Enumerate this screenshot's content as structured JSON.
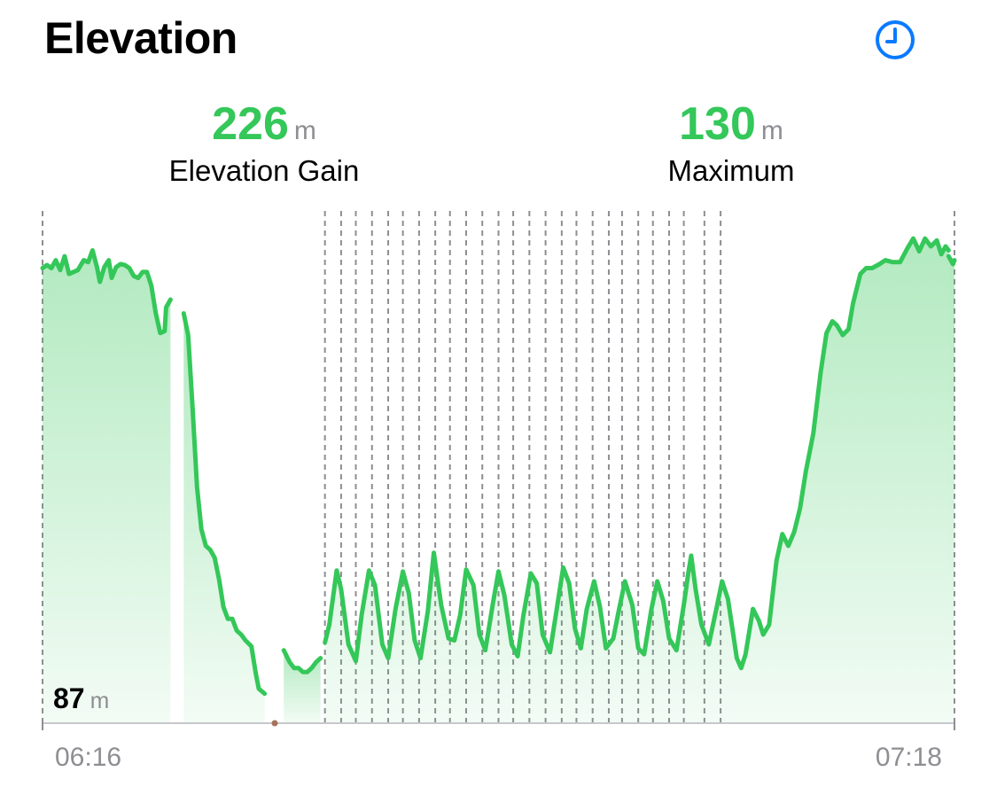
{
  "header": {
    "title": "Elevation",
    "clock_icon": "clock-icon"
  },
  "stats": {
    "gain": {
      "value": "226",
      "unit": "m",
      "label": "Elevation Gain"
    },
    "max": {
      "value": "130",
      "unit": "m",
      "label": "Maximum"
    }
  },
  "colors": {
    "accent": "#34c759",
    "link": "#0a7aff",
    "secondary_text": "#8e8e93"
  },
  "chart_data": {
    "type": "area",
    "xlabel": "",
    "ylabel": "",
    "y_unit": "m",
    "x_ticks": [
      "06:16",
      "07:18"
    ],
    "x_range_minutes": [
      0,
      62
    ],
    "ylim": [
      82,
      134
    ],
    "grid": "dashed vertical segment markers",
    "min_label": {
      "value": "87",
      "unit": "m"
    },
    "segments": [
      {
        "points": [
          [
            0,
            128.2
          ],
          [
            0.3,
            128.5
          ],
          [
            0.6,
            128.2
          ],
          [
            0.9,
            129
          ],
          [
            1.2,
            128
          ],
          [
            1.5,
            129.4
          ],
          [
            1.8,
            127.6
          ],
          [
            2.1,
            127.8
          ],
          [
            2.4,
            128
          ],
          [
            2.8,
            129
          ],
          [
            3.1,
            128.8
          ],
          [
            3.4,
            130
          ],
          [
            3.7,
            128.3
          ],
          [
            3.9,
            126.8
          ],
          [
            4.2,
            128.3
          ],
          [
            4.5,
            129
          ],
          [
            4.7,
            127.2
          ],
          [
            5,
            128.3
          ],
          [
            5.3,
            128.6
          ],
          [
            5.6,
            128.5
          ],
          [
            5.9,
            128.2
          ],
          [
            6.2,
            127.4
          ],
          [
            6.5,
            127.2
          ],
          [
            6.8,
            127.8
          ],
          [
            7.1,
            127.8
          ],
          [
            7.4,
            126.4
          ],
          [
            7.7,
            123.6
          ],
          [
            8.0,
            121.6
          ],
          [
            8.3,
            121.8
          ],
          [
            8.4,
            124.2
          ],
          [
            8.7,
            125.0
          ]
        ]
      },
      {
        "points": [
          [
            9.6,
            123.6
          ],
          [
            9.9,
            121.4
          ],
          [
            10.2,
            114
          ],
          [
            10.5,
            106
          ],
          [
            10.8,
            101.7
          ],
          [
            11.1,
            100
          ],
          [
            11.4,
            99.6
          ],
          [
            11.7,
            98.8
          ],
          [
            12,
            96.6
          ],
          [
            12.3,
            93.8
          ],
          [
            12.6,
            92.6
          ],
          [
            12.9,
            92.6
          ],
          [
            13.2,
            91.4
          ],
          [
            13.5,
            91.0
          ],
          [
            13.8,
            90.4
          ],
          [
            14.2,
            89.8
          ],
          [
            14.5,
            87
          ],
          [
            14.7,
            85.5
          ],
          [
            15.1,
            85
          ]
        ]
      },
      {
        "points": [
          [
            16.4,
            89.4
          ],
          [
            16.8,
            88.2
          ],
          [
            17.1,
            87.6
          ],
          [
            17.4,
            87.6
          ],
          [
            17.7,
            87.2
          ],
          [
            18.0,
            87.2
          ],
          [
            18.3,
            87.6
          ],
          [
            18.6,
            88.2
          ],
          [
            18.9,
            88.6
          ]
        ]
      },
      {
        "points": [
          [
            19.2,
            90.2
          ],
          [
            19.5,
            92
          ],
          [
            20.0,
            97.5
          ],
          [
            20.3,
            95.6
          ],
          [
            20.8,
            90
          ],
          [
            21.3,
            88.3
          ],
          [
            21.7,
            93
          ],
          [
            22.2,
            97.5
          ],
          [
            22.6,
            96
          ],
          [
            23.1,
            90
          ],
          [
            23.5,
            88.6
          ],
          [
            24.0,
            93.6
          ],
          [
            24.5,
            97.4
          ],
          [
            24.9,
            95.2
          ],
          [
            25.3,
            90.4
          ],
          [
            25.7,
            88.6
          ],
          [
            26.2,
            93.4
          ],
          [
            26.6,
            99.3
          ],
          [
            27.1,
            94
          ],
          [
            27.6,
            90.6
          ],
          [
            28.0,
            90.4
          ],
          [
            28.4,
            93
          ],
          [
            28.8,
            97.6
          ],
          [
            29.3,
            96
          ],
          [
            29.7,
            91
          ],
          [
            30.1,
            89.4
          ],
          [
            30.6,
            94
          ],
          [
            31.0,
            97.4
          ],
          [
            31.4,
            95
          ],
          [
            31.9,
            90
          ],
          [
            32.3,
            88.8
          ],
          [
            32.7,
            93
          ],
          [
            33.2,
            97.2
          ],
          [
            33.6,
            96.2
          ],
          [
            34.0,
            91
          ],
          [
            34.5,
            89.2
          ],
          [
            34.9,
            93
          ],
          [
            35.4,
            97.8
          ],
          [
            35.8,
            96.2
          ],
          [
            36.2,
            91.6
          ],
          [
            36.6,
            89.6
          ],
          [
            37.0,
            93.6
          ],
          [
            37.5,
            96.4
          ],
          [
            37.9,
            93.8
          ],
          [
            38.3,
            89.6
          ],
          [
            38.8,
            90.6
          ],
          [
            39.2,
            93.6
          ],
          [
            39.6,
            96.4
          ],
          [
            40.1,
            94
          ],
          [
            40.5,
            89.6
          ],
          [
            40.9,
            89
          ],
          [
            41.4,
            93.6
          ],
          [
            41.8,
            96.4
          ],
          [
            42.2,
            94.4
          ],
          [
            42.6,
            90.6
          ],
          [
            43.1,
            89.4
          ],
          [
            43.6,
            94
          ],
          [
            43.9,
            97.2
          ],
          [
            44.1,
            99
          ],
          [
            44.4,
            95.6
          ],
          [
            44.8,
            92
          ],
          [
            45.3,
            90
          ],
          [
            45.8,
            93.5
          ],
          [
            46.2,
            96.4
          ],
          [
            46.6,
            94.6
          ],
          [
            47.2,
            88.6
          ],
          [
            47.5,
            87.6
          ],
          [
            47.8,
            89
          ],
          [
            48.3,
            93.6
          ],
          [
            48.7,
            92.4
          ],
          [
            49.0,
            91
          ],
          [
            49.4,
            92
          ],
          [
            49.9,
            98.5
          ],
          [
            50.3,
            101.2
          ],
          [
            50.7,
            100
          ],
          [
            51.1,
            101.4
          ],
          [
            51.5,
            103.8
          ],
          [
            51.9,
            107.6
          ],
          [
            52.4,
            111.4
          ],
          [
            52.9,
            117.6
          ],
          [
            53.3,
            121.6
          ],
          [
            53.7,
            122.8
          ],
          [
            54.0,
            122.4
          ],
          [
            54.4,
            121.4
          ],
          [
            54.8,
            122.0
          ],
          [
            55.1,
            124.6
          ],
          [
            55.6,
            127.6
          ],
          [
            56.0,
            128.2
          ],
          [
            56.4,
            128.2
          ],
          [
            56.9,
            128.6
          ],
          [
            57.3,
            129
          ],
          [
            57.8,
            128.8
          ],
          [
            58.3,
            128.8
          ],
          [
            58.8,
            130.2
          ],
          [
            59.2,
            131.2
          ],
          [
            59.6,
            129.9
          ],
          [
            60.0,
            131.2
          ],
          [
            60.4,
            130.4
          ],
          [
            60.8,
            131
          ],
          [
            61.1,
            129.6
          ],
          [
            61.4,
            130.4
          ],
          [
            61.6,
            130
          ]
        ]
      },
      {
        "points": [
          [
            61.6,
            129.4
          ],
          [
            61.9,
            128.6
          ],
          [
            62,
            129
          ]
        ]
      }
    ],
    "marker_times": [
      0,
      19.2,
      20.3,
      21.3,
      22.4,
      23.5,
      24.5,
      25.6,
      26.7,
      27.7,
      28.8,
      29.9,
      31.0,
      32.0,
      33.1,
      34.2,
      35.3,
      36.3,
      37.4,
      38.5,
      39.4,
      40.5,
      41.5,
      42.6,
      43.6,
      45.0,
      46.1,
      62
    ]
  }
}
